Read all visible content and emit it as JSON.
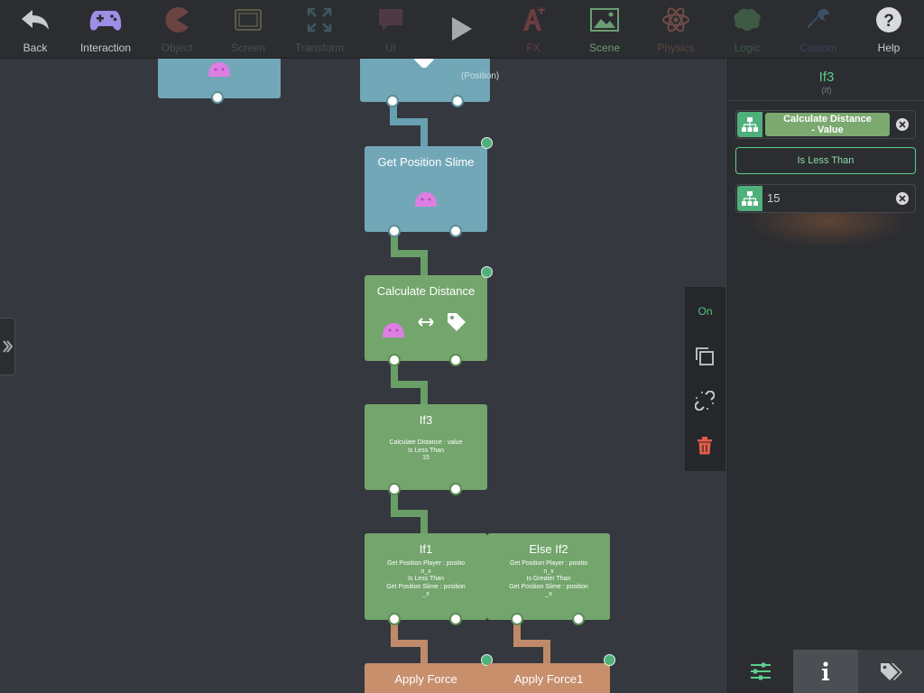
{
  "toolbar": {
    "back": "Back",
    "interaction": "Interaction",
    "object": "Object",
    "screen": "Screen",
    "transform": "Transform",
    "ui": "UI",
    "fx": "FX",
    "scene": "Scene",
    "physics": "Physics",
    "logic": "Logic",
    "custom": "Custom",
    "help": "Help"
  },
  "nodes": {
    "top_label": "(Position)",
    "get_position_slime": "Get Position Slime",
    "calculate_distance": "Calculate Distance",
    "if3": {
      "title": "If3",
      "line1": "Calculate Distance : value",
      "line2": "Is Less Than",
      "line3": "15"
    },
    "if1": {
      "title": "If1",
      "line1": "Get Position Player : positio",
      "line2": "n_x",
      "line3": "Is Less Than",
      "line4": "Get Position Slime : position",
      "line5": "_x"
    },
    "else_if2": {
      "title": "Else If2",
      "line1": "Get Position Player : positio",
      "line2": "n_x",
      "line3": "Is Greater Than",
      "line4": "Get Position Slime : position",
      "line5": "_x"
    },
    "apply_force": "Apply Force",
    "apply_force1": "Apply Force1"
  },
  "side_tools": {
    "on_label": "On"
  },
  "panel": {
    "title": "If3",
    "subtitle": "(If)",
    "input_a": "Calculate Distance\n- Value",
    "comparator": "Is Less Than",
    "input_b": "15"
  }
}
